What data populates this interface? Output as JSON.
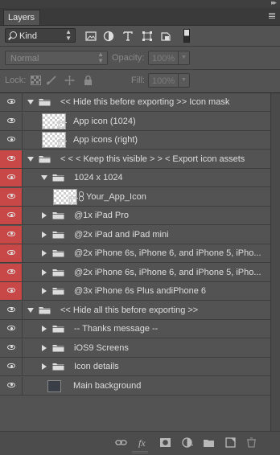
{
  "panel": {
    "tab_title": "Layers"
  },
  "filter": {
    "kind_label": "Kind",
    "icons": [
      "image-icon",
      "adjustment-icon",
      "type-icon",
      "shape-icon",
      "smart-object-icon"
    ]
  },
  "blend": {
    "mode": "Normal",
    "opacity_label": "Opacity:",
    "opacity_value": "100%",
    "lock_label": "Lock:",
    "fill_label": "Fill:",
    "fill_value": "100%"
  },
  "layers": [
    {
      "name": "<< Hide this before exporting >> Icon mask",
      "type": "group",
      "expanded": true,
      "indent": 0,
      "eye": "grey"
    },
    {
      "name": "App icon (1024)",
      "type": "smart",
      "indent": 1,
      "eye": "grey"
    },
    {
      "name": "App icons (right)",
      "type": "smart",
      "indent": 1,
      "eye": "grey"
    },
    {
      "name": "< < < Keep this visible > > < Export icon assets",
      "type": "group",
      "expanded": true,
      "indent": 0,
      "eye": "red"
    },
    {
      "name": "1024 x 1024",
      "type": "group",
      "expanded": true,
      "indent": 1,
      "eye": "red"
    },
    {
      "name": "Your_App_Icon",
      "type": "smart-link",
      "indent": 2,
      "eye": "red"
    },
    {
      "name": "@1x iPad Pro",
      "type": "group",
      "expanded": false,
      "indent": 1,
      "eye": "red"
    },
    {
      "name": "@2x iPad and iPad mini",
      "type": "group",
      "expanded": false,
      "indent": 1,
      "eye": "red"
    },
    {
      "name": "@2x iPhone 6s, iPhone 6, and iPhone 5, iPho...",
      "type": "group",
      "expanded": false,
      "indent": 1,
      "eye": "red"
    },
    {
      "name": "@2x iPhone 6s, iPhone 6, and iPhone 5, iPho...",
      "type": "group",
      "expanded": false,
      "indent": 1,
      "eye": "red"
    },
    {
      "name": "@3x iPhone 6s Plus andiPhone 6",
      "type": "group",
      "expanded": false,
      "indent": 1,
      "eye": "red"
    },
    {
      "name": "<< Hide all this before exporting >>",
      "type": "group",
      "expanded": true,
      "indent": 0,
      "eye": "grey"
    },
    {
      "name": "-- Thanks message --",
      "type": "group",
      "expanded": false,
      "indent": 1,
      "eye": "grey"
    },
    {
      "name": "iOS9 Screens",
      "type": "group",
      "expanded": false,
      "indent": 1,
      "eye": "grey"
    },
    {
      "name": "Icon details",
      "type": "group",
      "expanded": false,
      "indent": 1,
      "eye": "grey"
    },
    {
      "name": "Main background",
      "type": "fill",
      "indent": 0,
      "eye": "grey"
    }
  ],
  "footer_icons": [
    "link-layers-icon",
    "fx-icon",
    "add-mask-icon",
    "adjustment-layer-icon",
    "new-group-icon",
    "new-layer-icon",
    "delete-layer-icon"
  ],
  "colors": {
    "panel_bg": "#535353",
    "red_visibility": "#c84848"
  }
}
